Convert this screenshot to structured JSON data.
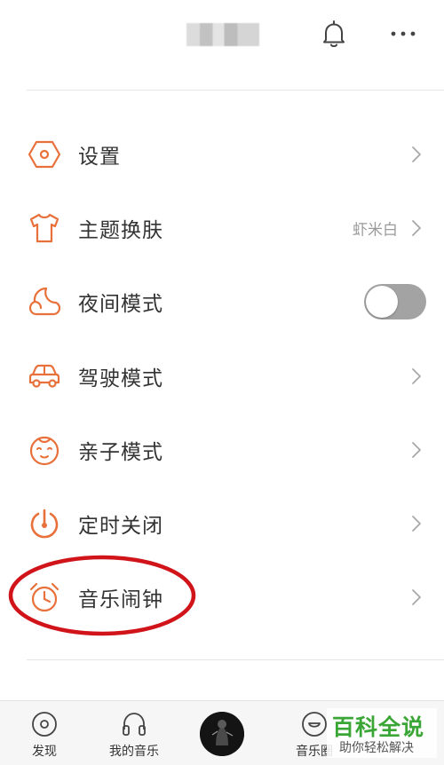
{
  "header": {
    "bell_icon": "bell-icon",
    "more_icon": "more-horizontal-icon"
  },
  "menu": {
    "items": [
      {
        "icon": "settings-hexagon-icon",
        "label": "设置",
        "type": "chevron"
      },
      {
        "icon": "tshirt-icon",
        "label": "主题换肤",
        "value": "虾米白",
        "type": "value-chevron"
      },
      {
        "icon": "moon-cloud-icon",
        "label": "夜间模式",
        "type": "toggle",
        "toggle_on": false
      },
      {
        "icon": "car-icon",
        "label": "驾驶模式",
        "type": "chevron"
      },
      {
        "icon": "baby-face-icon",
        "label": "亲子模式",
        "type": "chevron"
      },
      {
        "icon": "timer-icon",
        "label": "定时关闭",
        "type": "chevron"
      },
      {
        "icon": "alarm-clock-icon",
        "label": "音乐闹钟",
        "type": "chevron"
      }
    ]
  },
  "bottom_nav": {
    "items": [
      {
        "icon": "disc-icon",
        "label": "发现"
      },
      {
        "icon": "headphones-icon",
        "label": "我的音乐"
      },
      {
        "icon": "now-playing-cover",
        "label": ""
      },
      {
        "icon": "smile-bubble-icon",
        "label": "音乐圈"
      }
    ]
  },
  "watermark": {
    "title": "百科全说",
    "subtitle": "助你轻松解决"
  },
  "colors": {
    "accent_icon": "#e8703a",
    "highlight_red": "#d0141a",
    "toggle_off": "#a3a3a3",
    "watermark_green": "#3aa635"
  }
}
